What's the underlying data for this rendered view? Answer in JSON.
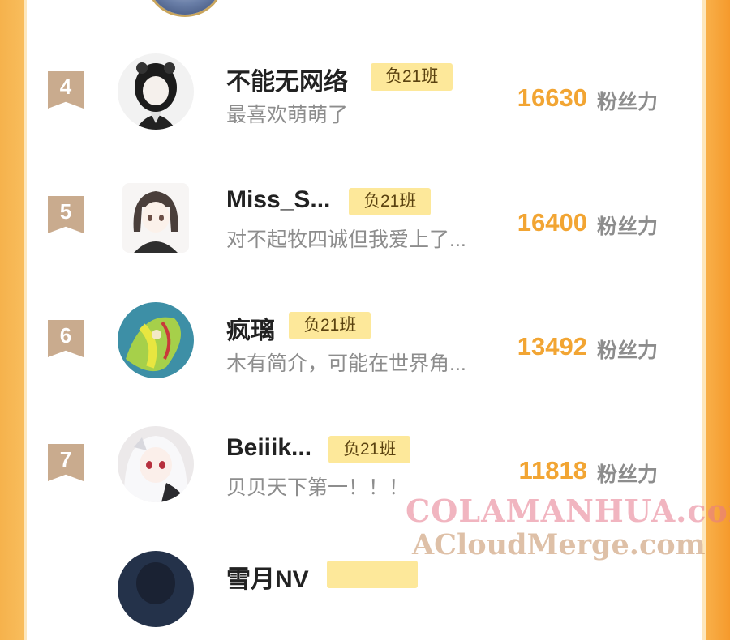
{
  "leaderboard": {
    "unit_label": "粉丝力",
    "rows": [
      {
        "rank": "4",
        "name": "不能无网络",
        "badge": "负21班",
        "bio": "最喜欢萌萌了",
        "score": "16630"
      },
      {
        "rank": "5",
        "name": "Miss_S...",
        "badge": "负21班",
        "bio": "对不起牧四诚但我爱上了...",
        "score": "16400"
      },
      {
        "rank": "6",
        "name": "疯璃",
        "badge": "负21班",
        "bio": "木有简介，可能在世界角...",
        "score": "13492"
      },
      {
        "rank": "7",
        "name": "Beiiik...",
        "badge": "负21班",
        "bio": "贝贝天下第一！！！",
        "score": "11818"
      },
      {
        "rank": "",
        "name": "雪月NV",
        "badge": "",
        "bio": "",
        "score": ""
      }
    ]
  },
  "watermark": {
    "line1": "COLAMANHUA.com",
    "line2": "ACloudMerge.com"
  },
  "colors": {
    "score": "#f2a533",
    "badge_bg": "#fde89a",
    "rank_bg": "#c9ab8e",
    "side_orange": "#f8b04a"
  }
}
